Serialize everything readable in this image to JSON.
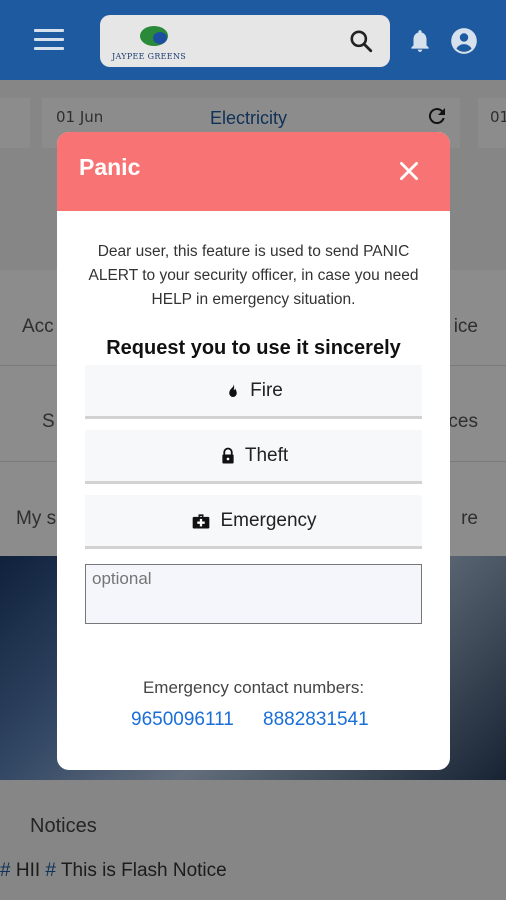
{
  "header": {
    "logo_text": "JAYPEE GREENS",
    "icons": [
      "menu-icon",
      "search-icon",
      "bell-icon",
      "account-icon"
    ]
  },
  "background": {
    "date_left": "01 Jun",
    "date_right": "01",
    "utility": "Electricity",
    "row1_left": "Acc",
    "row1_right": "ice",
    "row2_left": "S",
    "row2_right": "ces",
    "row3_left": "My s",
    "row3_right": "re",
    "notices_title": "Notices",
    "flash_1": "HII",
    "flash_2": "This is Flash Notice"
  },
  "modal": {
    "title": "Panic",
    "description": "Dear user, this feature is used to send PANIC ALERT to your security officer, in case you need HELP in emergency situation.",
    "request_text": "Request you to use it sincerely",
    "options": [
      {
        "label": "Fire",
        "icon": "fire-icon"
      },
      {
        "label": "Theft",
        "icon": "lock-icon"
      },
      {
        "label": "Emergency",
        "icon": "medical-kit-icon"
      }
    ],
    "optional_placeholder": "optional",
    "contact_title": "Emergency contact numbers:",
    "phones": [
      "9650096111",
      "8882831541"
    ]
  },
  "colors": {
    "topbar": "#1e5aa0",
    "modal_header": "#f87474",
    "link": "#1a6ed8"
  }
}
